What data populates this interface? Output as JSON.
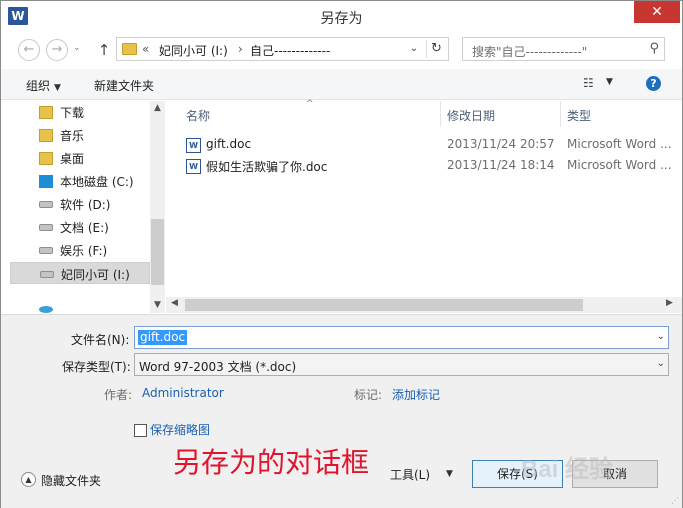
{
  "window": {
    "app_icon": "W",
    "title": "另存为",
    "close_glyph": "✕",
    "close_color": "#c7372f"
  },
  "address": {
    "back_glyph": "←",
    "forward_glyph": "→",
    "up_glyph": "↑",
    "crumb_prefix": "«",
    "crumb_drive": "妃同小可 (I:)",
    "crumb_sep": "›",
    "crumb_folder": "自己-------------",
    "dropdown_glyph": "⌄",
    "refresh_glyph": "↻"
  },
  "search": {
    "placeholder": "搜索\"自己-------------\"",
    "icon": "search-icon"
  },
  "toolbar": {
    "organize_label": "组织",
    "new_folder_label": "新建文件夹",
    "view_glyph": "☷",
    "help_glyph": "?"
  },
  "nav": {
    "items": [
      {
        "label": "下载",
        "icon": "folder-icon"
      },
      {
        "label": "音乐",
        "icon": "folder-icon"
      },
      {
        "label": "桌面",
        "icon": "folder-icon"
      },
      {
        "label": "本地磁盘 (C:)",
        "icon": "windows-drive-icon"
      },
      {
        "label": "软件 (D:)",
        "icon": "drive-icon"
      },
      {
        "label": "文档 (E:)",
        "icon": "drive-icon"
      },
      {
        "label": "娱乐 (F:)",
        "icon": "drive-icon"
      },
      {
        "label": "妃同小可 (I:)",
        "icon": "drive-icon",
        "selected": true
      }
    ]
  },
  "filelist": {
    "columns": {
      "name": "名称",
      "date": "修改日期",
      "type": "类型"
    },
    "files": [
      {
        "name": "gift.doc",
        "date": "2013/11/24 20:57",
        "type": "Microsoft Word ..."
      },
      {
        "name": "假如生活欺骗了你.doc",
        "date": "2013/11/24 18:14",
        "type": "Microsoft Word ..."
      }
    ]
  },
  "form": {
    "filename_label": "文件名(N):",
    "filename_value": "gift.doc",
    "filetype_label": "保存类型(T):",
    "filetype_value": "Word 97-2003 文档 (*.doc)",
    "author_label": "作者:",
    "author_value": "Administrator",
    "tags_label": "标记:",
    "tags_value": "添加标记",
    "thumbnail_label": "保存缩略图",
    "thumbnail_checked": false,
    "hide_folders_label": "隐藏文件夹",
    "tools_label": "工具(L)",
    "save_label": "保存(S)",
    "cancel_label": "取消"
  },
  "annotation": {
    "text": "另存为的对话框",
    "color": "#e0152d"
  },
  "watermark": {
    "text": "Bai 经验"
  }
}
